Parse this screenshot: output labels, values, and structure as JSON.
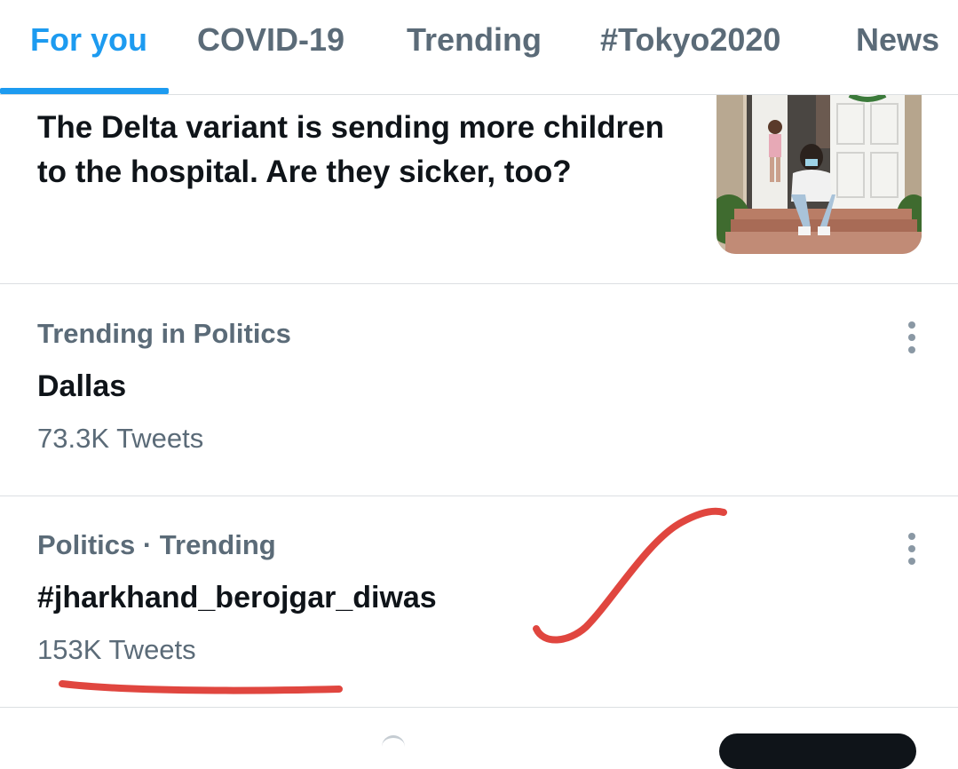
{
  "tabs": [
    {
      "label": "For you",
      "active": true
    },
    {
      "label": "COVID-19",
      "active": false
    },
    {
      "label": "Trending",
      "active": false
    },
    {
      "label": "#Tokyo2020",
      "active": false
    },
    {
      "label": "News",
      "active": false
    }
  ],
  "story": {
    "title": "The Delta variant is sending more children to the hospital. Are they sicker, too?"
  },
  "trends": [
    {
      "context": "Trending in Politics",
      "name": "Dallas",
      "count": "73.3K Tweets"
    },
    {
      "context": "Politics · Trending",
      "name": "#jharkhand_berojgar_diwas",
      "count": "153K Tweets"
    }
  ],
  "colors": {
    "accent": "#1d9bf0",
    "secondary_text": "#5b6b78",
    "annotation_red": "#e0463f"
  },
  "icons": [
    "more-vertical-icon"
  ]
}
